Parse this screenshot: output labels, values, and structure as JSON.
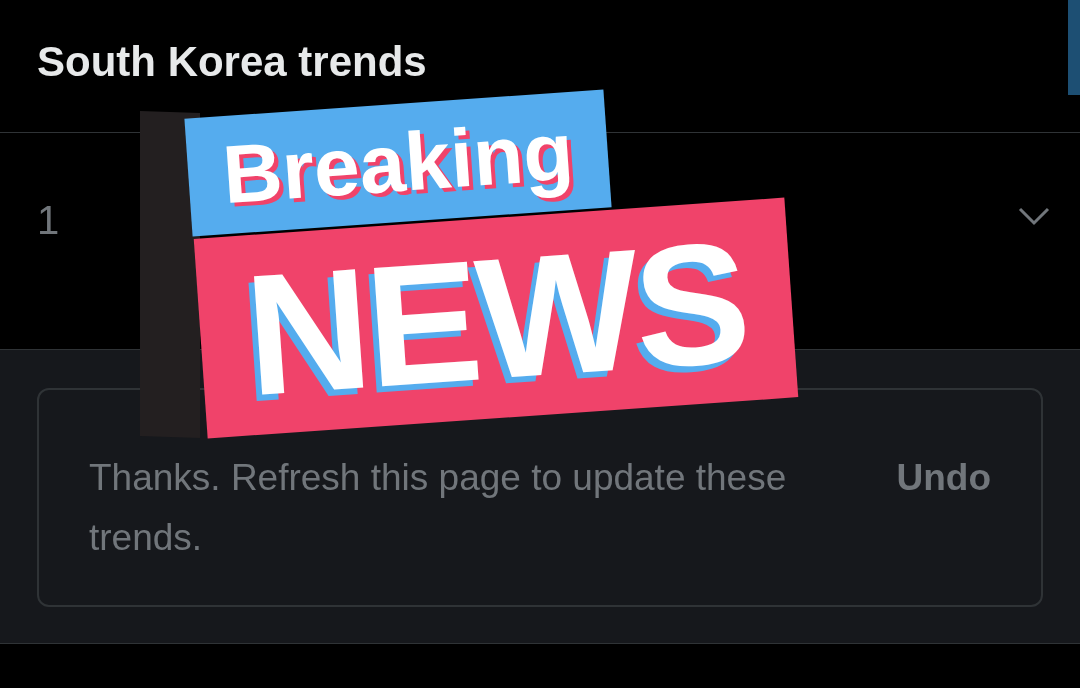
{
  "header": {
    "title": "South Korea trends"
  },
  "trends": [
    {
      "rank": "1"
    }
  ],
  "notice": {
    "message": "Thanks. Refresh this page to update these trends.",
    "action": "Undo"
  },
  "sticker": {
    "top": "Breaking",
    "bottom": "NEWS"
  }
}
